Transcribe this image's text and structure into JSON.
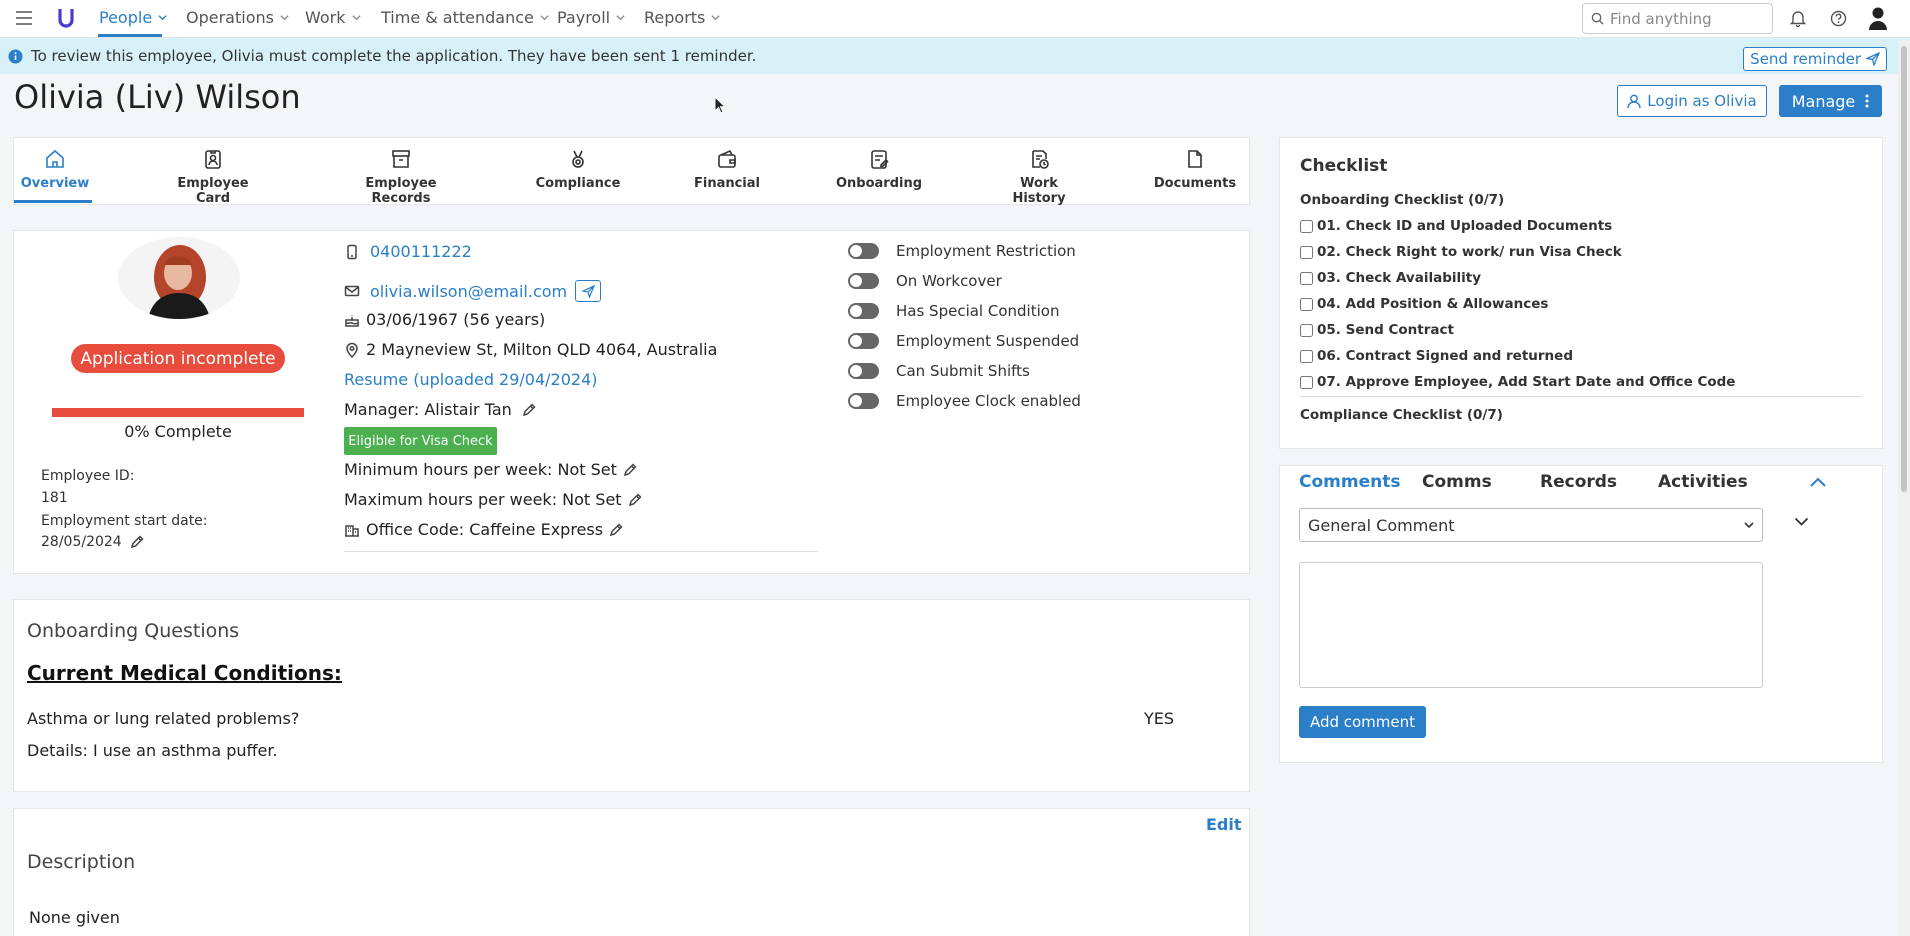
{
  "nav": {
    "items": [
      {
        "label": "People",
        "active": true
      },
      {
        "label": "Operations"
      },
      {
        "label": "Work"
      },
      {
        "label": "Time & attendance"
      },
      {
        "label": "Payroll"
      },
      {
        "label": "Reports"
      }
    ],
    "search_placeholder": "Find anything"
  },
  "banner": {
    "text": "To review this employee, Olivia must complete the application. They have been sent 1 reminder.",
    "send_reminder": "Send reminder"
  },
  "page": {
    "title": "Olivia (Liv) Wilson",
    "login_as": "Login as Olivia",
    "manage": "Manage"
  },
  "tabs": [
    {
      "label": "Overview",
      "icon": "home-icon"
    },
    {
      "label": "Employee Card",
      "icon": "id-badge-icon"
    },
    {
      "label": "Employee Records",
      "icon": "archive-icon"
    },
    {
      "label": "Compliance",
      "icon": "medal-icon"
    },
    {
      "label": "Financial",
      "icon": "wallet-icon"
    },
    {
      "label": "Onboarding",
      "icon": "clipboard-edit-icon"
    },
    {
      "label": "Work History",
      "icon": "history-icon"
    },
    {
      "label": "Documents",
      "icon": "document-icon"
    }
  ],
  "profile": {
    "status_badge": "Application incomplete",
    "progress_fraction": 0.0,
    "progress_text": "0% Complete",
    "employee_id_label": "Employee ID:",
    "employee_id": "181",
    "start_date_label": "Employment start date:",
    "start_date": "28/05/2024",
    "phone": "0400111222",
    "email": "olivia.wilson@email.com",
    "dob": "03/06/1967 (56 years)",
    "address": "2 Mayneview St, Milton QLD 4064, Australia",
    "resume": "Resume (uploaded 29/04/2024)",
    "manager": "Manager: Alistair Tan",
    "visa_badge": "Eligible for Visa Check",
    "min_hours": "Minimum hours per week: Not Set",
    "max_hours": "Maximum hours per week: Not Set",
    "office_code": "Office Code: Caffeine Express"
  },
  "toggles": [
    {
      "label": "Employment Restriction",
      "on": false
    },
    {
      "label": "On Workcover",
      "on": false
    },
    {
      "label": "Has Special Condition",
      "on": false
    },
    {
      "label": "Employment Suspended",
      "on": false
    },
    {
      "label": "Can Submit Shifts",
      "on": false
    },
    {
      "label": "Employee Clock enabled",
      "on": false
    }
  ],
  "onboarding_questions": {
    "title": "Onboarding Questions",
    "section": "Current Medical Conditions:",
    "question": "Asthma or lung related problems?",
    "answer": "YES",
    "details": "Details: I use an asthma puffer."
  },
  "description": {
    "edit": "Edit",
    "title": "Description",
    "text": "None given"
  },
  "checklist": {
    "title": "Checklist",
    "onboarding_title": "Onboarding Checklist (0/7)",
    "items": [
      "01. Check ID and Uploaded Documents",
      "02. Check Right to work/ run Visa Check",
      "03. Check Availability",
      "04. Add Position & Allowances",
      "05. Send Contract",
      "06. Contract Signed and returned",
      "07. Approve Employee, Add Start Date and Office Code"
    ],
    "compliance_title": "Compliance Checklist (0/7)"
  },
  "comments": {
    "tabs": [
      "Comments",
      "Comms",
      "Records",
      "Activities"
    ],
    "select_value": "General Comment",
    "add_button": "Add comment"
  }
}
